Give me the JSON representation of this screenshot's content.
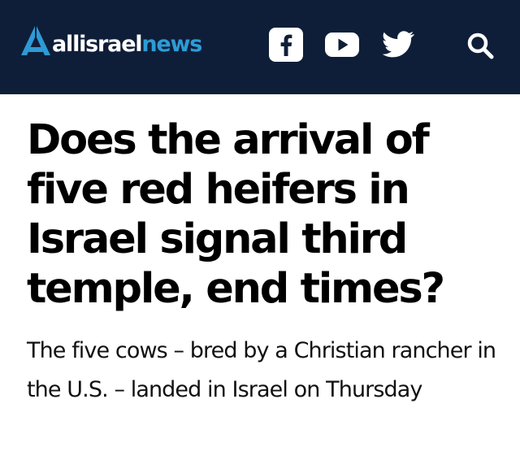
{
  "header": {
    "logo_text_light": "allisrael",
    "logo_text_accent": "news",
    "brand_color": "#2d9bd6",
    "background_color": "#0f1e38",
    "icons": [
      "facebook-icon",
      "youtube-icon",
      "twitter-icon",
      "search-icon"
    ]
  },
  "article": {
    "headline": "Does the arrival of five red heifers in Israel signal third temple, end times?",
    "subheadline": "The five cows – bred by a Christian rancher in the U.S. – landed in Israel on Thursday"
  }
}
